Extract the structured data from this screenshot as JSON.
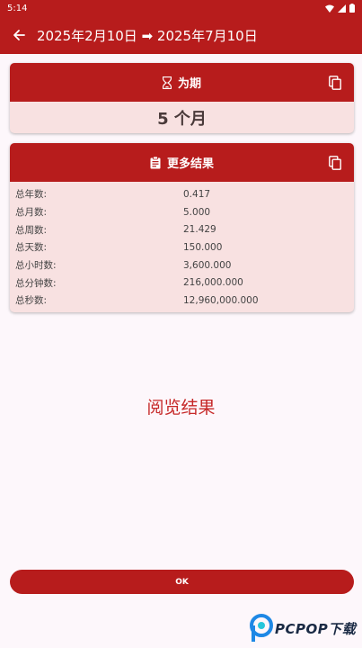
{
  "status_bar": {
    "time": "5:14"
  },
  "app_bar": {
    "title": "2025年2月10日 ➡ 2025年7月10日"
  },
  "duration_card": {
    "title": "为期",
    "value": "5 个月"
  },
  "results_card": {
    "title": "更多结果",
    "rows": [
      {
        "label": "总年数:",
        "value": "0.417"
      },
      {
        "label": "总月数:",
        "value": "5.000"
      },
      {
        "label": "总周数:",
        "value": "21.429"
      },
      {
        "label": "总天数:",
        "value": "150.000"
      },
      {
        "label": "总小时数:",
        "value": "3,600.000"
      },
      {
        "label": "总分钟数:",
        "value": "216,000.000"
      },
      {
        "label": "总秒数:",
        "value": "12,960,000.000"
      }
    ]
  },
  "preview": {
    "title": "阅览结果"
  },
  "actions": {
    "ok_label": "OK"
  },
  "watermark": {
    "text": "PCPOP下载"
  },
  "colors": {
    "primary": "#b71c1c",
    "card_bg": "#f8e1e1",
    "page_bg": "#fdf7fb",
    "accent_text": "#c62828"
  }
}
